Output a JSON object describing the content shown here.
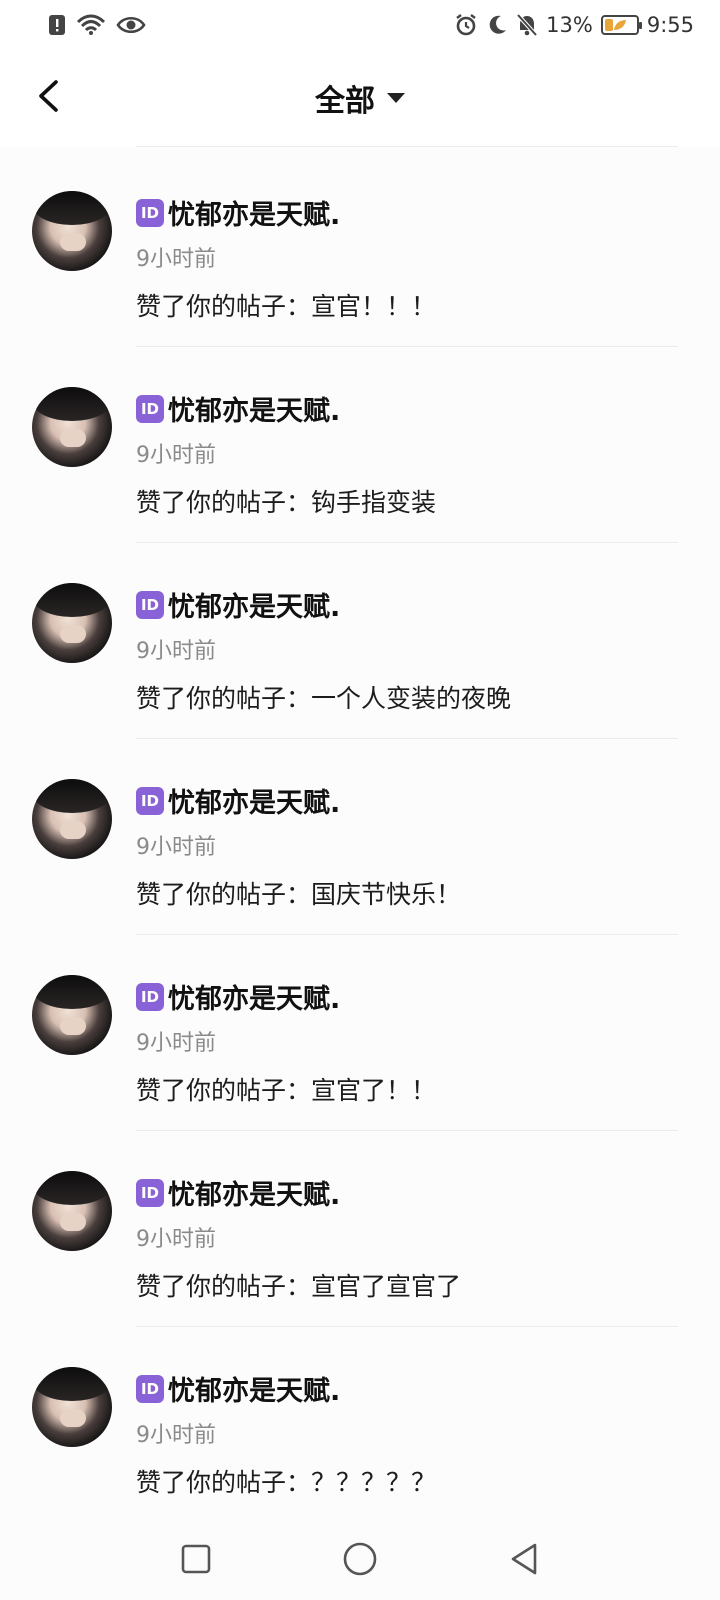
{
  "status_bar": {
    "battery_percent": "13%",
    "time": "9:55",
    "icons": [
      "alert-icon",
      "wifi-icon",
      "eye-icon",
      "alarm-icon",
      "moon-icon",
      "bell-off-icon",
      "battery-icon"
    ]
  },
  "header": {
    "title": "全部"
  },
  "items": [
    {
      "badge": "ID",
      "name": "忧郁亦是天赋.",
      "time": "9小时前",
      "text": "赞了你的帖子：宣官！！！"
    },
    {
      "badge": "ID",
      "name": "忧郁亦是天赋.",
      "time": "9小时前",
      "text": "赞了你的帖子：钩手指变装"
    },
    {
      "badge": "ID",
      "name": "忧郁亦是天赋.",
      "time": "9小时前",
      "text": "赞了你的帖子：一个人变装的夜晚"
    },
    {
      "badge": "ID",
      "name": "忧郁亦是天赋.",
      "time": "9小时前",
      "text": "赞了你的帖子：国庆节快乐！"
    },
    {
      "badge": "ID",
      "name": "忧郁亦是天赋.",
      "time": "9小时前",
      "text": "赞了你的帖子：宣官了！！"
    },
    {
      "badge": "ID",
      "name": "忧郁亦是天赋.",
      "time": "9小时前",
      "text": "赞了你的帖子：宣官了宣官了"
    },
    {
      "badge": "ID",
      "name": "忧郁亦是天赋.",
      "time": "9小时前",
      "text": "赞了你的帖子：？？？？？"
    }
  ],
  "nav": {
    "icons": [
      "square-icon",
      "circle-icon",
      "triangle-back-icon"
    ]
  }
}
